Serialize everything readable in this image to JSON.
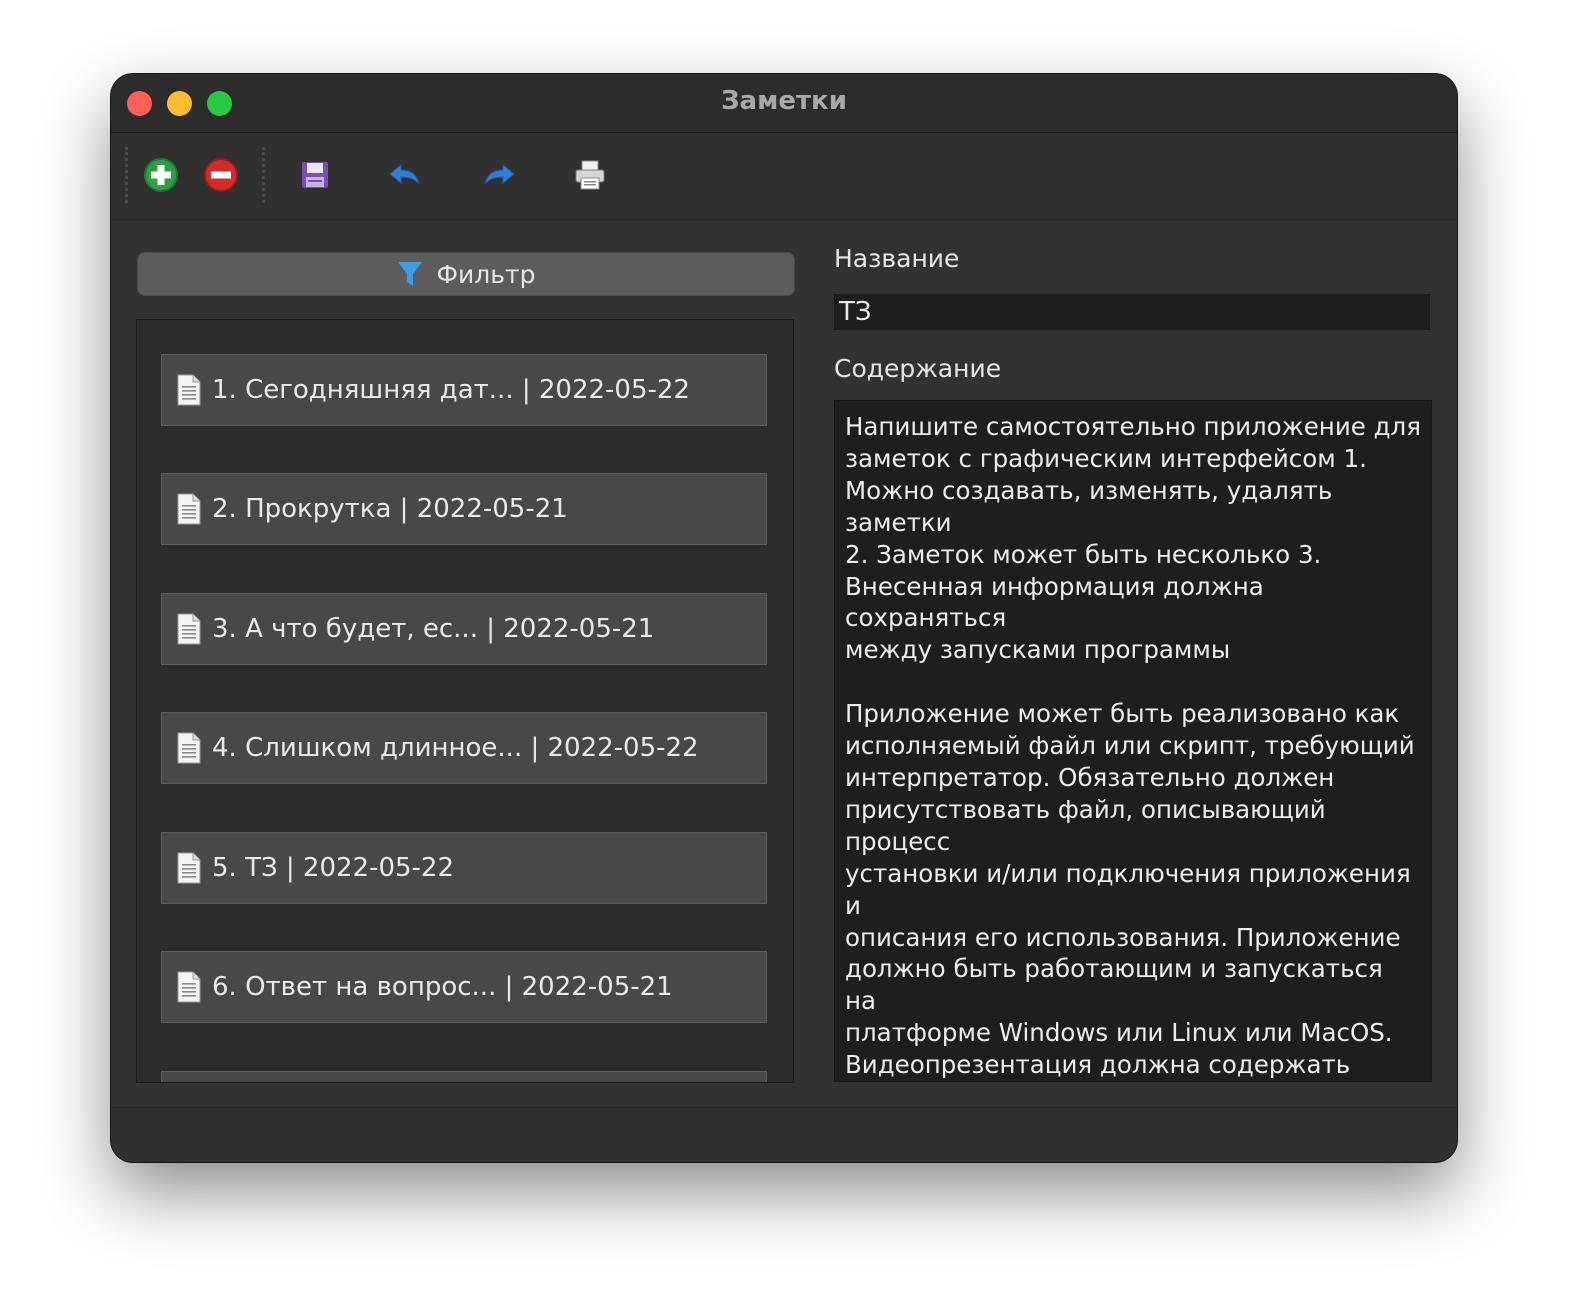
{
  "window": {
    "title": "Заметки"
  },
  "toolbar": {
    "buttons": [
      {
        "name": "add",
        "icon": "plus-circle-icon",
        "color": "#2ea043"
      },
      {
        "name": "delete",
        "icon": "minus-circle-icon",
        "color": "#d12b2b"
      },
      {
        "name": "save",
        "icon": "floppy-disk-icon",
        "color": "#7a4fb0"
      },
      {
        "name": "undo",
        "icon": "undo-arrow-icon",
        "color": "#2f7fd6"
      },
      {
        "name": "redo",
        "icon": "redo-arrow-icon",
        "color": "#2f7fd6"
      },
      {
        "name": "print",
        "icon": "printer-icon",
        "color": "#d9d9d9"
      }
    ]
  },
  "filter": {
    "label": "Фильтр",
    "icon": "funnel-icon"
  },
  "notes": [
    {
      "label": "1. Сегодняшняя дат... | 2022-05-22"
    },
    {
      "label": "2. Прокрутка | 2022-05-21"
    },
    {
      "label": "3. А что будет, ес... | 2022-05-21"
    },
    {
      "label": "4. Слишком длинное... | 2022-05-22"
    },
    {
      "label": "5. ТЗ | 2022-05-22"
    },
    {
      "label": "6. Ответ на вопрос... | 2022-05-21"
    }
  ],
  "editor": {
    "name_label": "Название",
    "name_value": "ТЗ",
    "content_label": "Содержание",
    "content_value": "Напишите самостоятельно приложение для\nзаметок с графическим интерфейсом 1.\nМожно создавать, изменять, удалять заметки\n2. Заметок может быть несколько 3.\nВнесенная информация должна сохраняться\nмежду запусками программы\n\nПриложение может быть реализовано как\nисполняемый файл или скрипт, требующий\nинтерпретатор. Обязательно должен\nприсутствовать файл, описывающий процесс\nустановки и/или подключения приложения и\nописания его использования. Приложение\nдолжно быть работающим и запускаться на\nплатформе Windows или Linux или MacOS.\nВидеопрезентация должна содержать\nописание разработки приложения,\nдемонстрацию работоспособности\nприложения. Презентация должна включать\nпостановку задачи, выбор и обоснование\nиспользуемых технологий, анализ процесса"
  }
}
